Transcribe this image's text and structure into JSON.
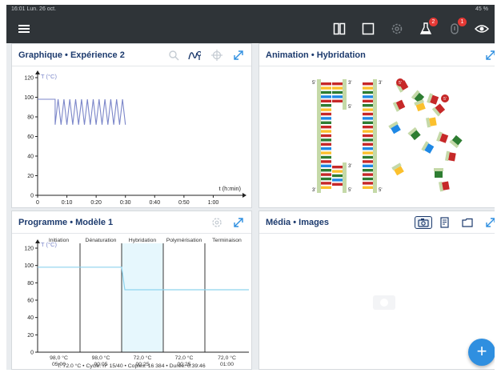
{
  "status": {
    "time": "16:01",
    "date": "Lun. 26 oct.",
    "battery": "45 %"
  },
  "topbar": {
    "menu_icon": "hamburger-icon",
    "tools": [
      "split-view-icon",
      "single-view-icon",
      "settings-icon",
      "flask-icon",
      "notification-icon",
      "eye-icon"
    ],
    "badges": {
      "flask": "2",
      "notification": "1"
    }
  },
  "panels": {
    "graph": {
      "title": "Graphique • Expérience 2"
    },
    "animation": {
      "title": "Animation • Hybridation",
      "strand_label_5": "5'",
      "strand_label_3": "3'"
    },
    "program": {
      "title": "Programme • Modèle 1",
      "footer": "T: 72.0 °C • Cycle: n° 15/40 • Copies: 16 384 • Durée: 0:39:46"
    },
    "media": {
      "title": "Média • Images"
    }
  },
  "graph_chart": {
    "type": "line",
    "ylabel": "T (°C)",
    "xlabel": "t (h:min)",
    "y_ticks": [
      "0",
      "20",
      "40",
      "60",
      "80",
      "100",
      "120"
    ],
    "x_ticks": [
      "0",
      "0:10",
      "0:20",
      "0:30",
      "0:40",
      "0:50",
      "1:00"
    ],
    "ylim": [
      0,
      120
    ],
    "xlim": [
      0,
      70
    ],
    "series_color": "#7b86c9"
  },
  "program_chart": {
    "ylabel": "T (°C)",
    "y_ticks": [
      "0",
      "20",
      "40",
      "60",
      "80",
      "100",
      "120"
    ],
    "steps": [
      {
        "name": "Initiation",
        "temp": "98,0 °C",
        "time": "05:00",
        "value": 98
      },
      {
        "name": "Dénaturation",
        "temp": "98,0 °C",
        "time": "00:05",
        "value": 98
      },
      {
        "name": "Hybridation",
        "temp": "72,0 °C",
        "time": "00:25",
        "value": 72
      },
      {
        "name": "Polymérisation",
        "temp": "72,0 °C",
        "time": "00:25",
        "value": 72
      },
      {
        "name": "Terminaison",
        "temp": "72,0 °C",
        "time": "01:00",
        "value": 72
      }
    ],
    "line_color": "#8ed4ee",
    "highlight_color": "#e6f7fd"
  },
  "chart_data": [
    {
      "type": "line",
      "title": "Graphique • Expérience 2",
      "ylabel": "T (°C)",
      "xlabel": "t (h:min)",
      "ylim": [
        0,
        120
      ],
      "xlim": [
        0,
        70
      ],
      "series": [
        {
          "values_note": "temperature",
          "x": [
            0,
            6,
            6,
            7,
            8,
            9,
            10,
            11,
            12,
            13,
            14,
            15,
            16,
            17,
            18,
            19,
            20,
            21,
            22,
            23,
            24,
            25,
            26,
            27,
            28,
            29,
            30
          ],
          "y": [
            98,
            98,
            72,
            98,
            72,
            98,
            72,
            98,
            72,
            98,
            72,
            98,
            72,
            98,
            72,
            98,
            72,
            98,
            72,
            98,
            72,
            98,
            72,
            98,
            72,
            98,
            72
          ]
        }
      ]
    },
    {
      "type": "line",
      "title": "Programme • Modèle 1",
      "ylabel": "T (°C)",
      "ylim": [
        0,
        120
      ],
      "categories": [
        "Initiation",
        "Dénaturation",
        "Hybridation",
        "Polymérisation",
        "Terminaison"
      ],
      "values": [
        98,
        98,
        72,
        72,
        72
      ]
    }
  ]
}
